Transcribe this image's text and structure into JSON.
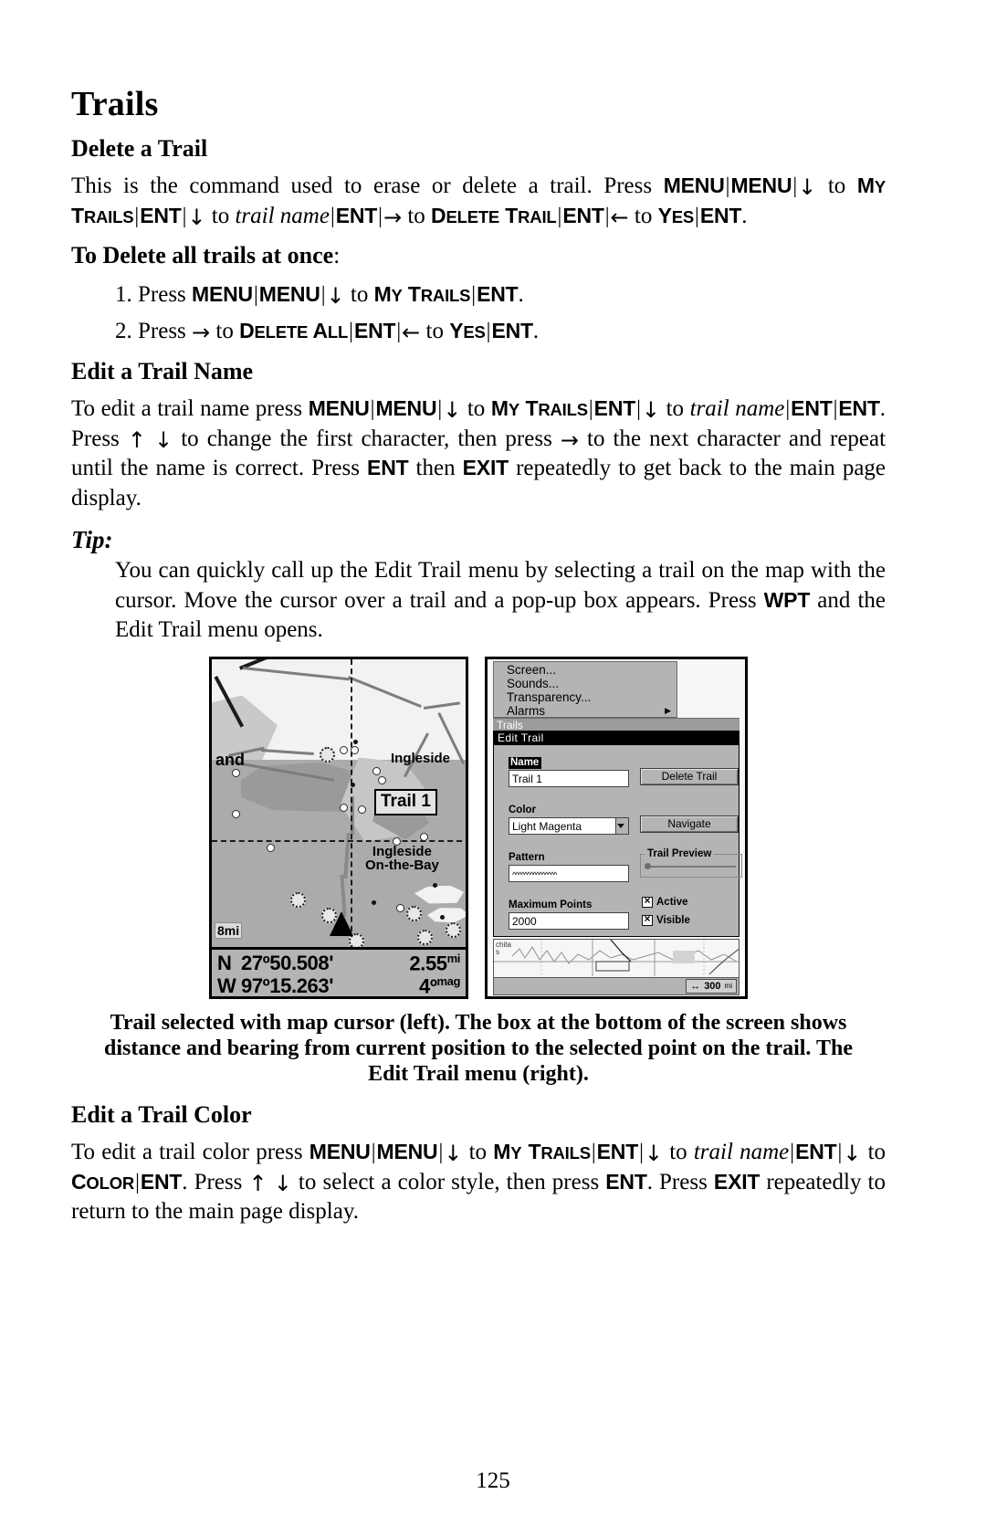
{
  "chapter_title": "Trails",
  "sections": {
    "delete_trail": {
      "heading": "Delete a Trail",
      "para_lead": "This is the command used to erase or delete a trail. Press",
      "keys": {
        "menu": "MENU",
        "down": "↓",
        "up": "↑",
        "right": "→",
        "left": "←",
        "ent": "ENT",
        "exit": "EXIT",
        "wpt": "WPT",
        "my_trails_1": "M",
        "my_trails_2": "Y",
        "my_trails_3": "T",
        "my_trails_4": "RAILS",
        "delete_trail_1": "D",
        "delete_trail_2": "ELETE",
        "delete_trail_3": "T",
        "delete_trail_4": "RAIL",
        "delete_all_1": "D",
        "delete_all_2": "ELETE",
        "delete_all_3": "A",
        "delete_all_4": "LL",
        "yes_1": "Y",
        "yes_2": "ES",
        "color_1": "C",
        "color_2": "OLOR",
        "trail_name": "trail name",
        "to": "to",
        "press": "Press",
        "sep": "|",
        "period": "."
      }
    },
    "delete_all": {
      "heading": "To Delete all trails at once",
      "heading_colon": ":",
      "step1_prefix": "1. Press",
      "step2_prefix": "2. Press"
    },
    "edit_trail_name": {
      "heading": "Edit a Trail Name",
      "lead": "To edit a trail name press",
      "mid1": "to",
      "mid2": "Press",
      "mid3": "to change the first character, then press",
      "mid4": "to the next character and repeat until the name is correct. Press",
      "mid5": "then",
      "mid6": "repeatedly to get back to the main page display."
    },
    "tip": {
      "heading": "Tip:",
      "body_a": "You can quickly call up the Edit Trail menu by selecting a trail on the map with the cursor. Move the cursor over a trail and a pop-up box appears. Press",
      "body_b": "and the Edit Trail menu opens."
    },
    "edit_trail_color": {
      "heading": "Edit a Trail Color",
      "lead": "To edit a trail color press",
      "mid1": "to",
      "mid2": "Press",
      "mid3": "to select a color style, then press",
      "mid4": "Press",
      "mid5": "repeatedly to return to the main page display."
    }
  },
  "figure": {
    "left_screen": {
      "name": "gps-map-screen",
      "map_labels": {
        "land": "and",
        "ingleside": "Ingleside",
        "ingleside_onbay_line1": "Ingleside",
        "ingleside_onbay_line2": "On-the-Bay",
        "popup_trail": "Trail 1",
        "scale": "8mi"
      },
      "data_bar": {
        "lat_label": "N",
        "lat_value": "27º50.508'",
        "lon_label": "W",
        "lon_value": "97º15.263'",
        "distance_value": "2.55",
        "distance_unit": "mi",
        "bearing_value": "4º",
        "bearing_unit": "mag"
      }
    },
    "right_screen": {
      "name": "edit-trail-menu-screen",
      "menu_items": [
        "Screen...",
        "Sounds...",
        "Transparency...",
        "Alarms"
      ],
      "title_bar": "Trails",
      "dialog_title": "Edit Trail",
      "fields": {
        "name_label": "Name",
        "name_value": "Trail 1",
        "color_label": "Color",
        "color_value": "Light Magenta",
        "pattern_label": "Pattern",
        "pattern_value": "^^^^^^^^^^^^^^^",
        "max_points_label": "Maximum Points",
        "max_points_value": "2000",
        "trail_preview_label": "Trail Preview",
        "active_label": "Active",
        "visible_label": "Visible"
      },
      "buttons": {
        "delete_trail": "Delete Trail",
        "navigate": "Navigate"
      },
      "bottom": {
        "map_label": "chita\ns",
        "scale_value": "300",
        "scale_unit": "mi"
      }
    },
    "caption": "Trail selected with map cursor (left). The box at the bottom of the screen shows distance and bearing from current position to the selected point on the trail. The Edit Trail menu (right)."
  },
  "page_number": "125"
}
